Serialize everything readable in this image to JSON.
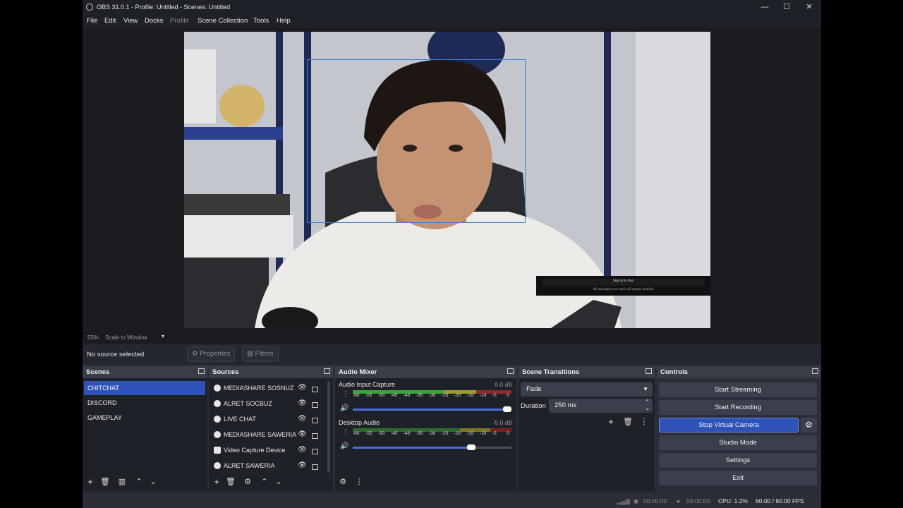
{
  "window": {
    "title": "OBS 31.0.1 - Profile: Untitled - Scenes: Untitled"
  },
  "menu": [
    "File",
    "Edit",
    "View",
    "Docks",
    "Profile",
    "Scene Collection",
    "Tools",
    "Help"
  ],
  "preview": {
    "zoom": "55%",
    "scale_mode": "Scale to Window",
    "chat_overlay": {
      "title": "Sign in to chat",
      "subtitle": "All messages you send will appear publicly"
    }
  },
  "properties_bar": {
    "no_source": "No source selected",
    "properties": "Properties",
    "filters": "Filters"
  },
  "scenes": {
    "title": "Scenes",
    "items": [
      "CHITCHAT",
      "DISCORD",
      "GAMEPLAY"
    ],
    "selected": "CHITCHAT"
  },
  "sources": {
    "title": "Sources",
    "items": [
      {
        "name": "MEDIASHARE SOSNUZ",
        "icon": "globe-icon"
      },
      {
        "name": "ALRET SOCBUZ",
        "icon": "globe-icon"
      },
      {
        "name": "LIVE CHAT",
        "icon": "globe-icon"
      },
      {
        "name": "MEDIASHARE SAWERIA",
        "icon": "globe-icon"
      },
      {
        "name": "Video Capture Device",
        "icon": "camera-icon"
      },
      {
        "name": "ALRET SAWERIA",
        "icon": "globe-icon"
      }
    ]
  },
  "audio_mixer": {
    "title": "Audio Mixer",
    "channels": [
      {
        "name": "Audio Input Capture",
        "db": "0.0 dB",
        "volume": 1.0
      },
      {
        "name": "Desktop Audio",
        "db": "-5.0 dB",
        "volume": 0.76
      }
    ],
    "scale": [
      "-60",
      "-55",
      "-50",
      "-45",
      "-40",
      "-35",
      "-30",
      "-25",
      "-20",
      "-15",
      "-10",
      "-5",
      "0"
    ]
  },
  "scene_transitions": {
    "title": "Scene Transitions",
    "transition": "Fade",
    "duration_label": "Duration",
    "duration": "250 ms"
  },
  "controls": {
    "title": "Controls",
    "buttons": [
      "Start Streaming",
      "Start Recording",
      "Stop Virtual Camera",
      "Studio Mode",
      "Settings",
      "Exit"
    ]
  },
  "status": {
    "stream_time": "00:00:00",
    "rec_time": "00:00:00",
    "cpu": "CPU: 1.2%",
    "fps": "60.00 / 60.00 FPS"
  },
  "colors": {
    "accent": "#2f52b8",
    "panel": "#2b2e38",
    "dark": "#1f2128"
  }
}
